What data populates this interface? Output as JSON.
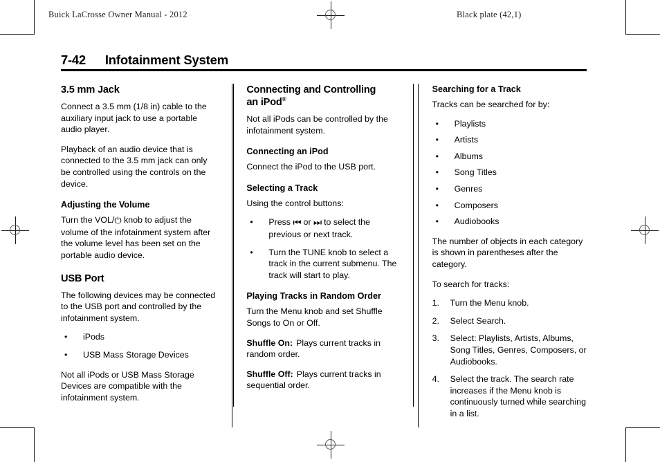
{
  "page": {
    "header_left": "Buick LaCrosse Owner Manual - 2012",
    "header_right": "Black plate (42,1)",
    "chapter_number": "7-42",
    "chapter_title": "Infotainment System"
  },
  "col1": {
    "heading": "3.5 mm Jack",
    "p1": "Connect a 3.5 mm (1/8 in) cable to the auxiliary input jack to use a portable audio player.",
    "p2": "Playback of an audio device that is connected to the 3.5 mm jack can only be controlled using the controls on the device.",
    "sub1": "Adjusting the Volume",
    "p3_pre": "Turn the VOL/",
    "p3_glyph": "⏻",
    "p3_post": " knob to adjust the volume of the infotainment system after the volume level has been set on the portable audio device.",
    "heading2": "USB Port",
    "p4": "The following devices may be connected to the USB port and controlled by the infotainment system.",
    "bullets": [
      "iPods",
      "USB Mass Storage Devices"
    ],
    "p5": "Not all iPods or USB Mass Storage Devices are compatible with the infotainment system."
  },
  "col2": {
    "heading_line1": "Connecting and Controlling",
    "heading_line2": "an iPod",
    "heading_sup": "®",
    "p1": "Not all iPods can be controlled by the infotainment system.",
    "sub1": "Connecting an iPod",
    "p2": "Connect the iPod to the USB port.",
    "sub2": "Selecting a Track",
    "p3": "Using the control buttons:",
    "bullet1_pre": "Press ",
    "bullet1_prev_glyph": "⏮",
    "bullet1_mid": " or ",
    "bullet1_next_glyph": "⏭",
    "bullet1_post": " to select the previous or next track.",
    "bullet2": "Turn the TUNE knob to select a track in the current submenu. The track will start to play.",
    "sub3": "Playing Tracks in Random Order",
    "p4": "Turn the Menu knob and set Shuffle Songs to On or Off.",
    "shuffle_on_label": "Shuffle On:",
    "shuffle_on_text": "Plays current tracks in random order.",
    "shuffle_off_label": "Shuffle Off:",
    "shuffle_off_text": "Plays current tracks in sequential order."
  },
  "col3": {
    "heading": "Searching for a Track",
    "p1": "Tracks can be searched for by:",
    "bullets": [
      "Playlists",
      "Artists",
      "Albums",
      "Song Titles",
      "Genres",
      "Composers",
      "Audiobooks"
    ],
    "p2": "The number of objects in each category is shown in parentheses after the category.",
    "p3": "To search for tracks:",
    "steps": [
      {
        "num": "1.",
        "text": "Turn the Menu knob."
      },
      {
        "num": "2.",
        "text": "Select Search."
      },
      {
        "num": "3.",
        "text": "Select: Playlists, Artists, Albums, Song Titles, Genres, Composers, or Audiobooks."
      },
      {
        "num": "4.",
        "text": "Select the track. The search rate increases if the Menu knob is continuously turned while searching in a list."
      }
    ]
  },
  "bullet_char": "•"
}
